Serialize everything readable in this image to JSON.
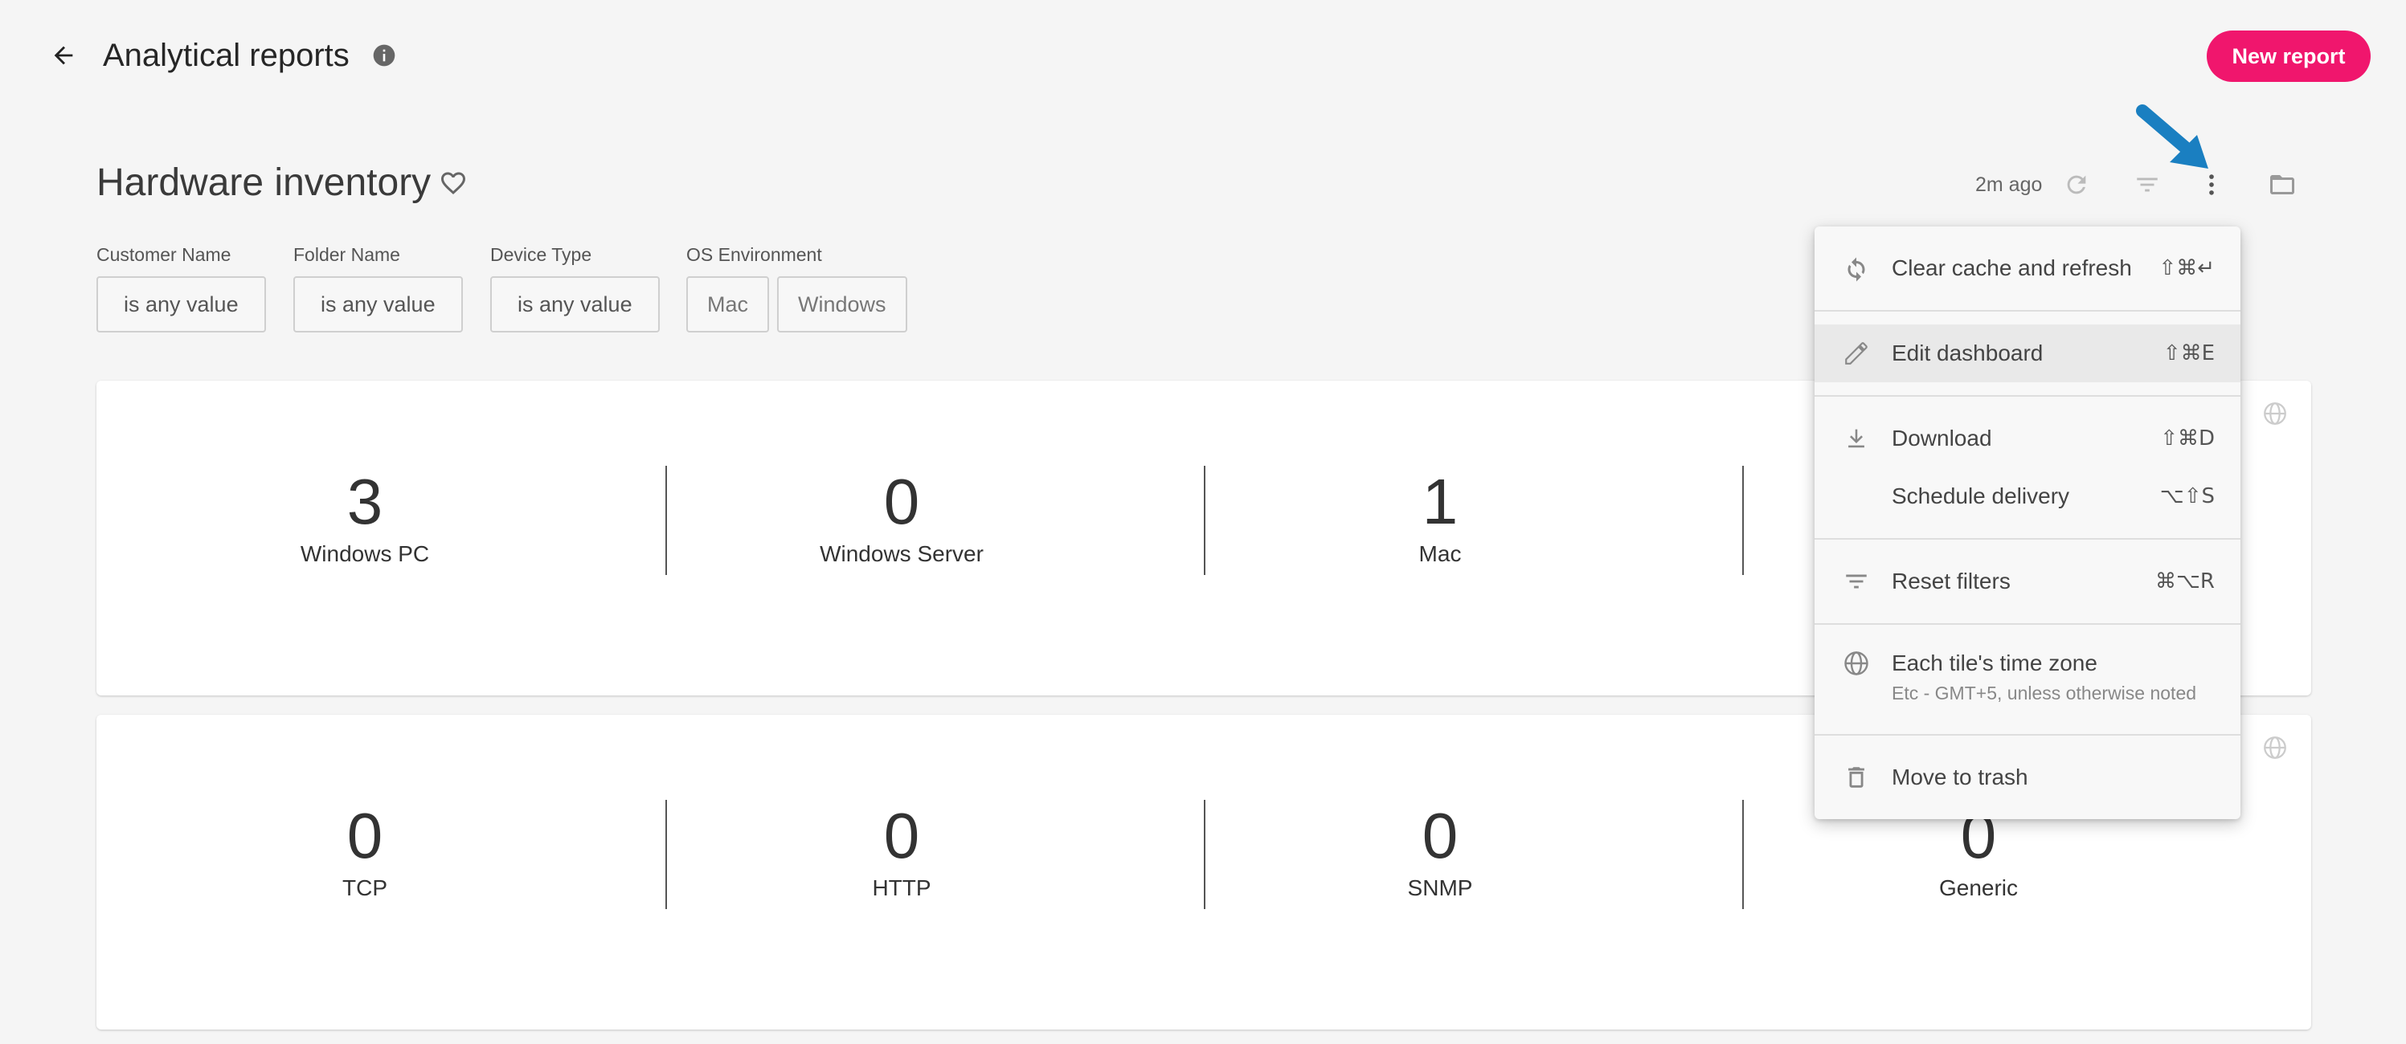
{
  "header": {
    "title": "Analytical reports",
    "new_report_label": "New report"
  },
  "dashboard": {
    "title": "Hardware inventory",
    "updated": "2m ago"
  },
  "filters": [
    {
      "label": "Customer Name",
      "chips": [
        "is any value"
      ]
    },
    {
      "label": "Folder Name",
      "chips": [
        "is any value"
      ]
    },
    {
      "label": "Device Type",
      "chips": [
        "is any value"
      ]
    },
    {
      "label": "OS Environment",
      "chips": [
        "Mac",
        "Windows"
      ]
    }
  ],
  "tiles": [
    {
      "stats": [
        {
          "value": "3",
          "label": "Windows PC"
        },
        {
          "value": "0",
          "label": "Windows Server"
        },
        {
          "value": "1",
          "label": "Mac"
        }
      ]
    },
    {
      "stats": [
        {
          "value": "0",
          "label": "TCP"
        },
        {
          "value": "0",
          "label": "HTTP"
        },
        {
          "value": "0",
          "label": "SNMP"
        },
        {
          "value": "0",
          "label": "Generic"
        }
      ]
    }
  ],
  "menu": {
    "items": [
      {
        "label": "Clear cache and refresh",
        "shortcut": "⇧⌘↵",
        "icon": "refresh-icon"
      },
      {
        "label": "Edit dashboard",
        "shortcut": "⇧⌘E",
        "icon": "pencil-icon"
      },
      {
        "label": "Download",
        "shortcut": "⇧⌘D",
        "icon": "download-icon"
      },
      {
        "label": "Schedule delivery",
        "shortcut": "⌥⇧S",
        "icon": ""
      },
      {
        "label": "Reset filters",
        "shortcut": "⌘⌥R",
        "icon": "filter-icon"
      },
      {
        "label": "Each tile's time zone",
        "sublabel": "Etc - GMT+5, unless otherwise noted",
        "icon": "globe-icon"
      },
      {
        "label": "Move to trash",
        "icon": "trash-icon"
      }
    ]
  },
  "colors": {
    "accent": "#f0166d",
    "annotation_arrow": "#1a7fc1"
  }
}
